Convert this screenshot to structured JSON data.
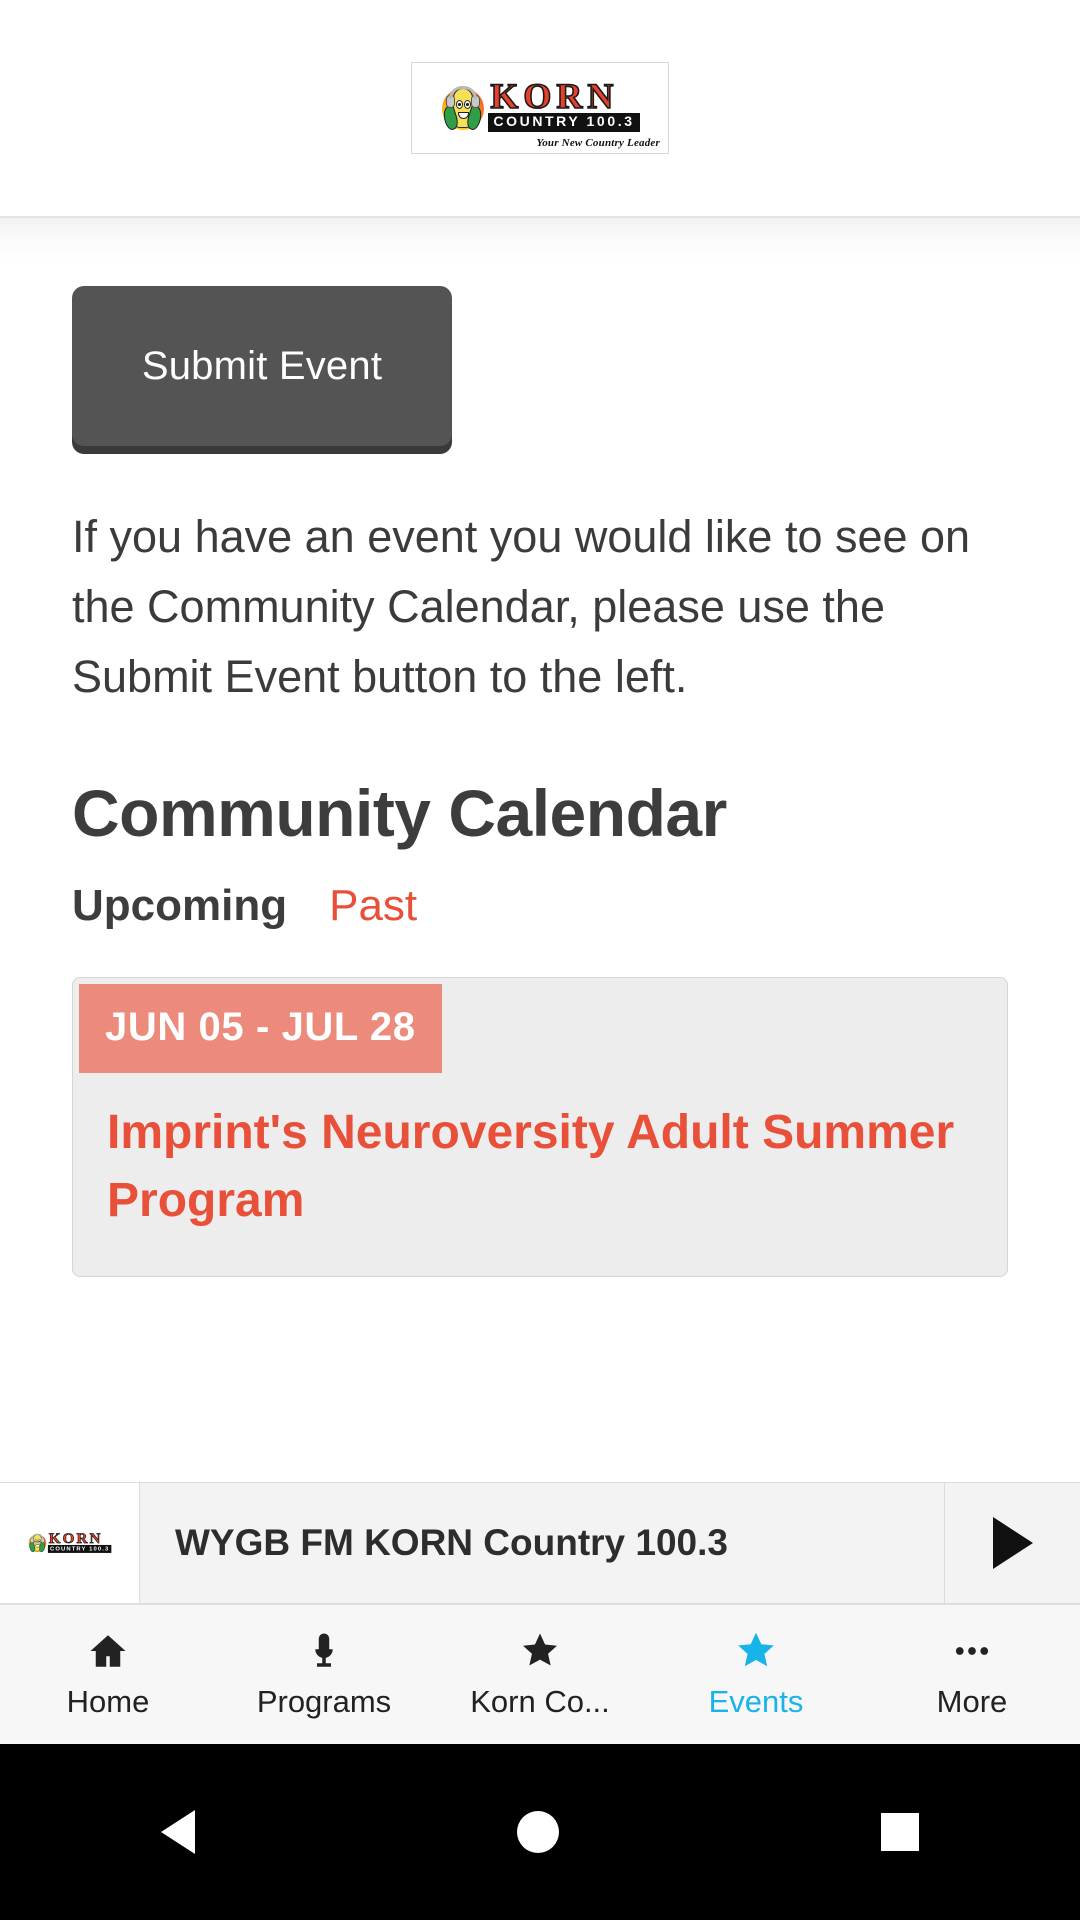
{
  "header": {
    "logo": {
      "station_name": "KORN",
      "frequency_line": "COUNTRY 100.3",
      "tagline": "Your New Country Leader",
      "icon": "corn-mascot-headphones-icon"
    }
  },
  "content": {
    "submit_button_label": "Submit Event",
    "intro_paragraph": "If you have an event you would like to see on the Community Calendar, please use the Submit Event button to the left.",
    "calendar_heading": "Community Calendar",
    "tabs": [
      {
        "label": "Upcoming",
        "active": true
      },
      {
        "label": "Past",
        "active": false
      }
    ],
    "events": [
      {
        "date_range": "JUN 05 - JUL 28",
        "title": "Imprint's Neuroversity Adult Summer Program"
      }
    ]
  },
  "player": {
    "now_playing": "WYGB FM KORN Country 100.3",
    "play_icon": "play-icon",
    "thumb_icon": "korn-logo-thumbnail"
  },
  "bottom_nav": [
    {
      "label": "Home",
      "icon": "home-icon",
      "active": false
    },
    {
      "label": "Programs",
      "icon": "microphone-icon",
      "active": false
    },
    {
      "label": "Korn Co...",
      "icon": "star-icon",
      "active": false
    },
    {
      "label": "Events",
      "icon": "star-filled-icon",
      "active": true
    },
    {
      "label": "More",
      "icon": "ellipsis-icon",
      "active": false
    }
  ],
  "system_bar": {
    "back": "back-triangle-icon",
    "home": "home-circle-icon",
    "recents": "recents-square-icon"
  },
  "colors": {
    "accent_red": "#e8503a",
    "date_badge": "#ec8a7b",
    "active_nav": "#18b4e9",
    "button_gray": "#545454"
  }
}
